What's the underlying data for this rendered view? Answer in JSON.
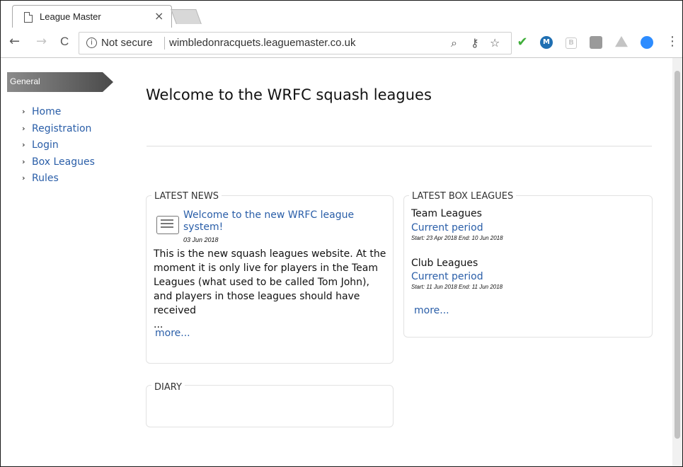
{
  "browser": {
    "tab_title": "League Master",
    "tab_close": "×",
    "nav": {
      "back": "←",
      "forward": "→",
      "reload": "C"
    },
    "security_icon": "i",
    "security_label": "Not secure",
    "url": "wimbledonracquets.leaguemaster.co.uk",
    "omnibox_icons": [
      "zoom-icon",
      "key-icon",
      "star-icon"
    ],
    "zoom_glyph": "⌕",
    "key_glyph": "⚷",
    "star_glyph": "☆",
    "menu_glyph": "⋮",
    "extensions": [
      {
        "name": "check-extension-icon",
        "color": "#3fae3a",
        "glyph": "✔"
      },
      {
        "name": "m-extension-icon",
        "color": "#1f6fb2",
        "glyph": "M"
      },
      {
        "name": "b-extension-icon",
        "color": "#c9c9c9",
        "glyph": "B"
      },
      {
        "name": "square-extension-icon",
        "color": "#9a9a9a",
        "glyph": ""
      },
      {
        "name": "drive-extension-icon",
        "color": "#c4c4c4",
        "glyph": ""
      },
      {
        "name": "zoom-extension-icon",
        "color": "#2d8cff",
        "glyph": ""
      }
    ]
  },
  "sidebar": {
    "header": "General",
    "items": [
      {
        "label": "Home"
      },
      {
        "label": "Registration"
      },
      {
        "label": "Login"
      },
      {
        "label": "Box Leagues"
      },
      {
        "label": "Rules"
      }
    ],
    "chevron": "›"
  },
  "main": {
    "title": "Welcome to the WRFC squash leagues",
    "news": {
      "heading": "LATEST NEWS",
      "headline": "Welcome to the new WRFC league system!",
      "date": "03 Jun 2018",
      "body": "This is the new squash leagues website.   At the moment it is only live for players in the Team Leagues (what used to be called Tom John), and players in those leagues should have received",
      "ellipsis": "...",
      "more": "more..."
    },
    "box_leagues": {
      "heading": "LATEST BOX LEAGUES",
      "leagues": [
        {
          "name": "Team Leagues",
          "period": "Current period",
          "dates": "Start: 23 Apr 2018 End: 10 Jun 2018"
        },
        {
          "name": "Club Leagues",
          "period": "Current period",
          "dates": "Start: 11 Jun 2018 End: 11 Jun 2018"
        }
      ],
      "more": "more..."
    },
    "diary": {
      "heading": "DIARY"
    }
  }
}
